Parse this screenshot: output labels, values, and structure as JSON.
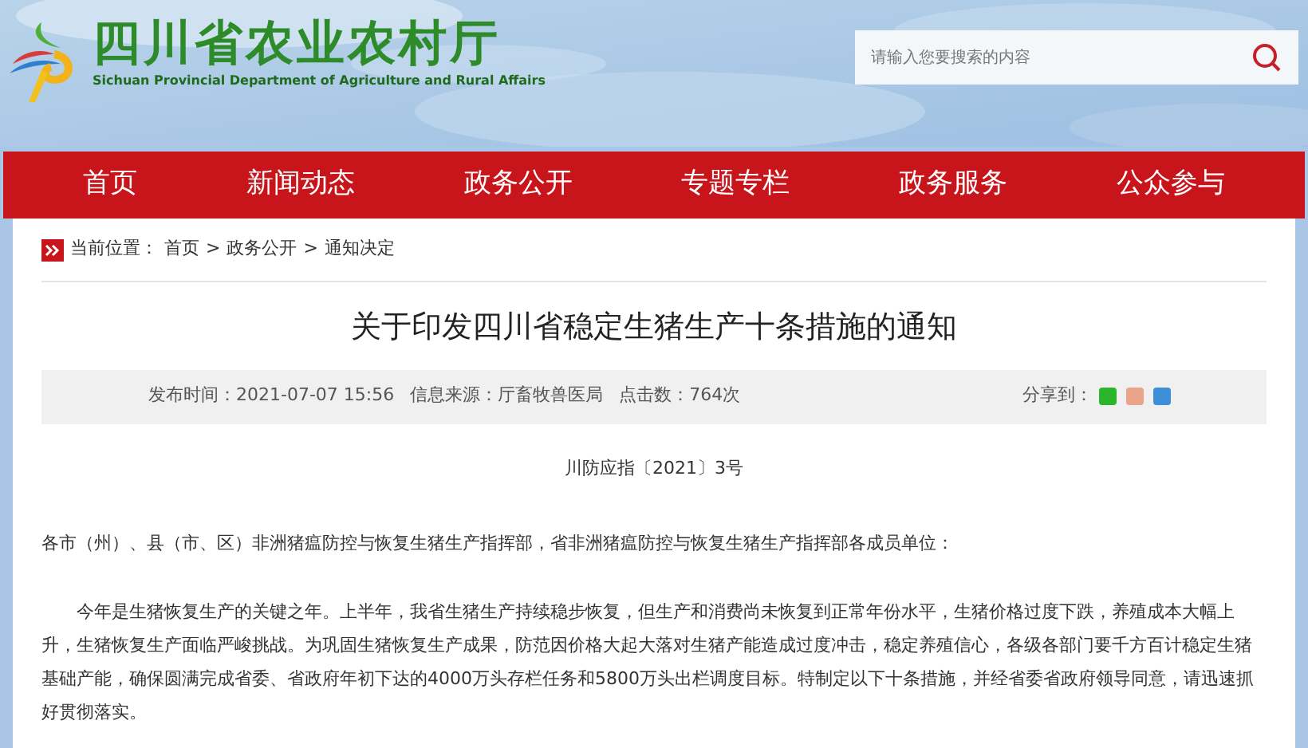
{
  "header": {
    "title": "四川省农业农村厅",
    "subtitle": "Sichuan Provincial Department of Agriculture and Rural Affairs",
    "search": {
      "placeholder": "请输入您要搜索的内容"
    }
  },
  "nav": {
    "items": [
      "首页",
      "新闻动态",
      "政务公开",
      "专题专栏",
      "政务服务",
      "公众参与"
    ]
  },
  "breadcrumb": {
    "label": "当前位置：",
    "items": [
      "首页",
      "政务公开",
      "通知决定"
    ],
    "separator": ">"
  },
  "article": {
    "title": "关于印发四川省稳定生猪生产十条措施的通知",
    "meta": [
      "发布时间：2021-07-07 15:56",
      "信息来源：厅畜牧兽医局",
      "点击数：764次"
    ],
    "share": {
      "label": "分享到："
    },
    "doc_number": "川防应指〔2021〕3号",
    "paragraphs": [
      {
        "kind": "salutation",
        "text": "各市（州）、县（市、区）非洲猪瘟防控与恢复生猪生产指挥部，省非洲猪瘟防控与恢复生猪生产指挥部各成员单位："
      },
      {
        "kind": "body",
        "text": "今年是生猪恢复生产的关键之年。上半年，我省生猪生产持续稳步恢复，但生产和消费尚未恢复到正常年份水平，生猪价格过度下跌，养殖成本大幅上升，生猪恢复生产面临严峻挑战。为巩固生猪恢复生产成果，防范因价格大起大落对生猪产能造成过度冲击，稳定养殖信心，各级各部门要千方百计稳定生猪基础产能，确保圆满完成省委、省政府年初下达的4000万头存栏任务和5800万头出栏调度目标。特制定以下十条措施，并经省委省政府领导同意，请迅速抓好贯彻落实。"
      }
    ]
  }
}
